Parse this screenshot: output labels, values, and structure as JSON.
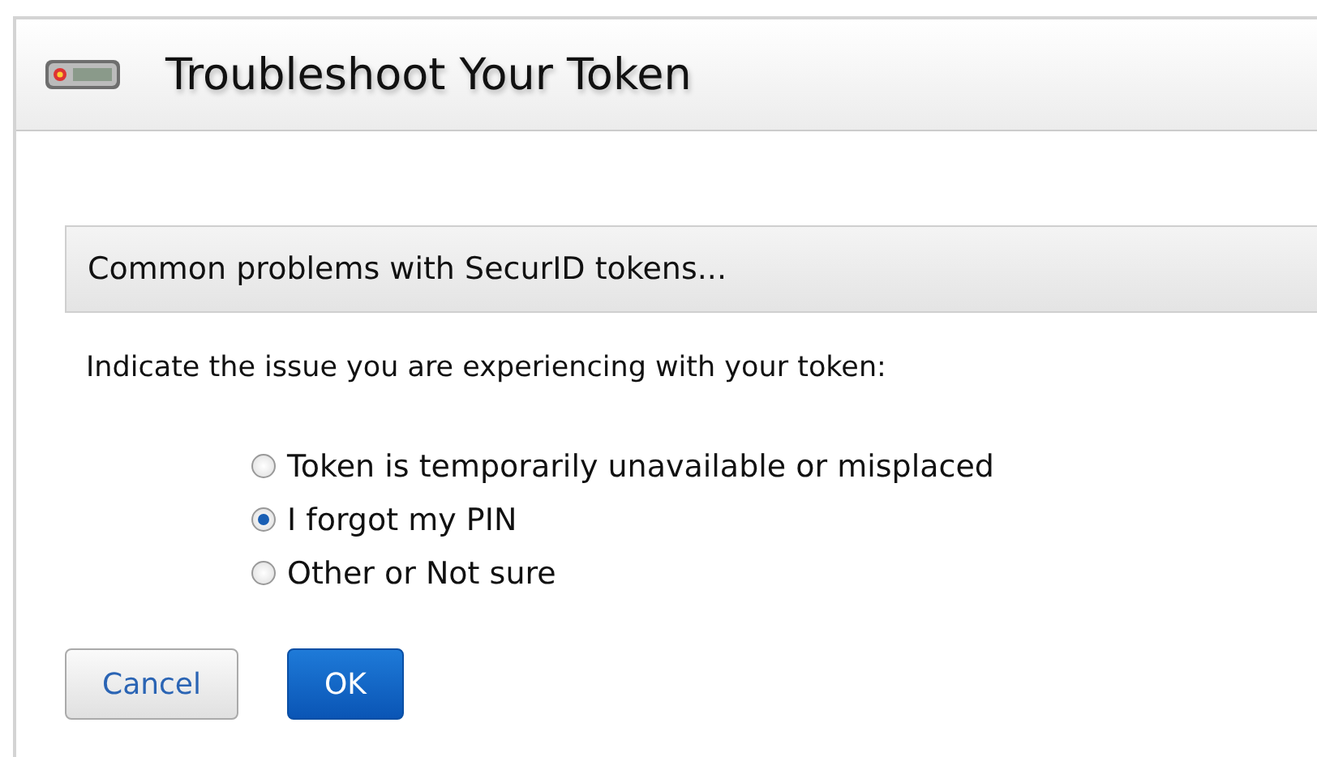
{
  "window": {
    "title": "Troubleshoot Your Token"
  },
  "section": {
    "title": "Common problems with SecurID tokens..."
  },
  "prompt": "Indicate the issue you are experiencing with your token:",
  "options": [
    {
      "label": "Token is temporarily unavailable or misplaced",
      "selected": false
    },
    {
      "label": "I forgot my PIN",
      "selected": true
    },
    {
      "label": "Other or Not sure",
      "selected": false
    }
  ],
  "buttons": [
    {
      "label": "Cancel",
      "kind": "secondary"
    },
    {
      "label": "OK",
      "kind": "primary"
    }
  ]
}
